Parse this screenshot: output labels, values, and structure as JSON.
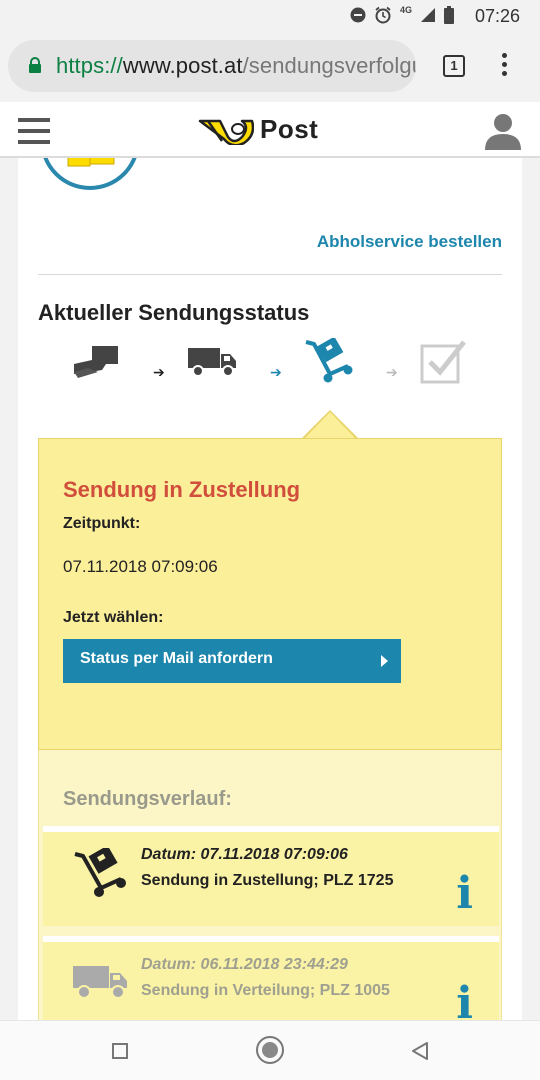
{
  "status_bar": {
    "time": "07:26",
    "network": "4G",
    "icons": [
      "do-not-disturb-icon",
      "alarm-icon",
      "signal-icon",
      "battery-icon"
    ]
  },
  "browser": {
    "url_scheme": "https://",
    "url_domain": "www.post.at",
    "url_path": "/sendungsverfolgu",
    "tab_count": "1"
  },
  "header": {
    "brand": "Post"
  },
  "content": {
    "pickup_link": "Abholservice bestellen",
    "status_title": "Aktueller Sendungsstatus",
    "steps": [
      "handover-icon",
      "truck-icon",
      "hand-truck-icon",
      "checkbox-icon"
    ],
    "current_step_index": 2,
    "current": {
      "title": "Sendung in Zustellung",
      "time_label": "Zeitpunkt:",
      "time_value": "07.11.2018 07:09:06",
      "choose_label": "Jetzt wählen:",
      "mail_button": "Status per Mail anfordern"
    },
    "history": {
      "title": "Sendungsverlauf:",
      "items": [
        {
          "date": "Datum: 07.11.2018 07:09:06",
          "text": "Sendung in Zustellung; PLZ 1725",
          "icon": "hand-truck-icon"
        },
        {
          "date": "Datum: 06.11.2018 23:44:29",
          "text": "Sendung in Verteilung; PLZ 1005",
          "icon": "truck-icon"
        }
      ]
    }
  },
  "colors": {
    "accent_blue": "#1d86ad",
    "status_red": "#d14e3c",
    "panel_yellow": "#fbef9a",
    "brand_yellow": "#ffdc00"
  }
}
